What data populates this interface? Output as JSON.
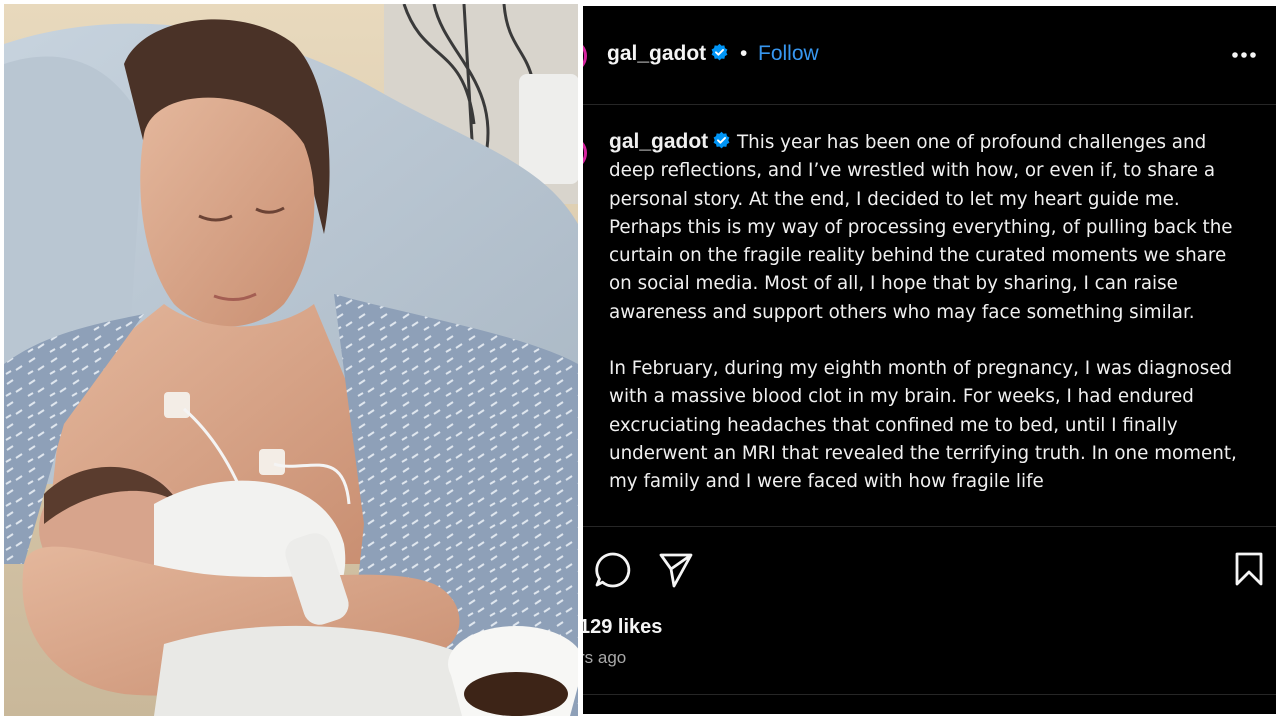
{
  "photo": {
    "alt_subject": "photo"
  },
  "post": {
    "username": "gal_gadot",
    "separator": "•",
    "follow_label": "Follow",
    "caption_paragraphs": [
      "This year has been one of profound challenges and deep reflections, and I’ve wrestled with how, or even if, to share a personal story. At the end, I decided to let my heart guide me. Perhaps this is my way of processing everything, of pulling back the curtain on the fragile reality behind the curated moments we share on social media. Most of all, I hope that by sharing, I can raise awareness and support others who may face something similar.",
      "In February, during my eighth month of pregnancy, I was diagnosed with a massive blood clot in my brain. For weeks, I had endured excruciating headaches that confined me to bed, until I finally underwent an MRI that revealed the terrifying truth. In one moment, my family and I were faced with how fragile life"
    ],
    "likes_text": "129 likes",
    "time_text": "rs ago"
  },
  "icons": {
    "verified": "verified-badge-icon",
    "more": "more-options-icon",
    "comment": "comment-icon",
    "share": "share-icon",
    "save": "bookmark-icon"
  },
  "colors": {
    "background": "#000000",
    "link": "#3897f0",
    "verified": "#0095f6",
    "text": "#f5f5f5",
    "muted": "#a8a8a8",
    "avatar_ring": "#d6249f"
  }
}
